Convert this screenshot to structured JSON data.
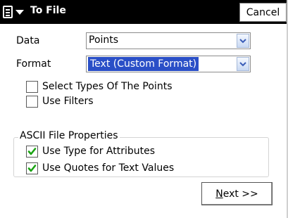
{
  "titlebar": {
    "menu_icon": "start-menu-icon",
    "title": "To File",
    "cancel_label": "Cancel"
  },
  "form": {
    "data_label": "Data",
    "data_value": "Points",
    "format_label": "Format",
    "format_value": "Text (Custom Format)"
  },
  "options": {
    "select_types_label": "Select Types Of The Points",
    "select_types_checked": false,
    "use_filters_label": "Use Filters",
    "use_filters_checked": false
  },
  "ascii": {
    "group_title": "ASCII File Properties",
    "use_type_label": "Use Type for Attributes",
    "use_type_checked": true,
    "use_quotes_label": "Use Quotes for Text Values",
    "use_quotes_checked": true
  },
  "footer": {
    "next_mnemonic": "N",
    "next_rest": "ext >>"
  },
  "colors": {
    "titlebar_bg": "#000000",
    "selection_bg": "#2a4fc7",
    "checkmark": "#1aa312"
  }
}
